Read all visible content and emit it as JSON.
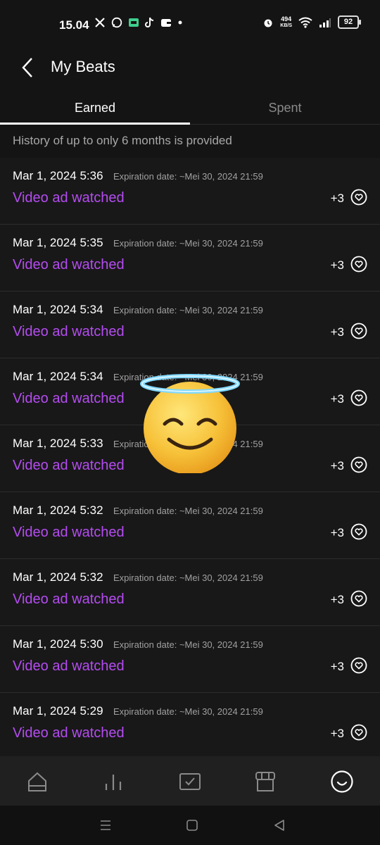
{
  "status_bar": {
    "time": "15.04",
    "left_icons": [
      "x-icon",
      "whatsapp-icon",
      "app-icon",
      "tiktok-icon",
      "wallet-icon",
      "dot-icon"
    ],
    "net_speed_value": "494",
    "net_speed_unit": "KB/S",
    "battery": "92"
  },
  "header": {
    "title": "My Beats"
  },
  "tabs": [
    {
      "label": "Earned",
      "active": true
    },
    {
      "label": "Spent",
      "active": false
    }
  ],
  "notice": "History of up to only 6 months is provided",
  "items": [
    {
      "date": "Mar 1, 2024 5:36",
      "expiration": "Expiration date: ~Mei 30, 2024 21:59",
      "description": "Video ad watched",
      "points": "+3"
    },
    {
      "date": "Mar 1, 2024 5:35",
      "expiration": "Expiration date: ~Mei 30, 2024 21:59",
      "description": "Video ad watched",
      "points": "+3"
    },
    {
      "date": "Mar 1, 2024 5:34",
      "expiration": "Expiration date: ~Mei 30, 2024 21:59",
      "description": "Video ad watched",
      "points": "+3"
    },
    {
      "date": "Mar 1, 2024 5:34",
      "expiration": "Expiration date: ~Mei 30, 2024 21:59",
      "description": "Video ad watched",
      "points": "+3"
    },
    {
      "date": "Mar 1, 2024 5:33",
      "expiration": "Expiration date: ~Mei 30, 2024 21:59",
      "description": "Video ad watched",
      "points": "+3"
    },
    {
      "date": "Mar 1, 2024 5:32",
      "expiration": "Expiration date: ~Mei 30, 2024 21:59",
      "description": "Video ad watched",
      "points": "+3"
    },
    {
      "date": "Mar 1, 2024 5:32",
      "expiration": "Expiration date: ~Mei 30, 2024 21:59",
      "description": "Video ad watched",
      "points": "+3"
    },
    {
      "date": "Mar 1, 2024 5:30",
      "expiration": "Expiration date: ~Mei 30, 2024 21:59",
      "description": "Video ad watched",
      "points": "+3"
    },
    {
      "date": "Mar 1, 2024 5:29",
      "expiration": "Expiration date: ~Mei 30, 2024 21:59",
      "description": "Video ad watched",
      "points": "+3"
    }
  ],
  "bottom_nav": [
    "home-icon",
    "charts-icon",
    "checklist-icon",
    "store-icon",
    "profile-smile-icon"
  ],
  "colors": {
    "accent_purple": "#b44cf0",
    "background": "#141414"
  }
}
